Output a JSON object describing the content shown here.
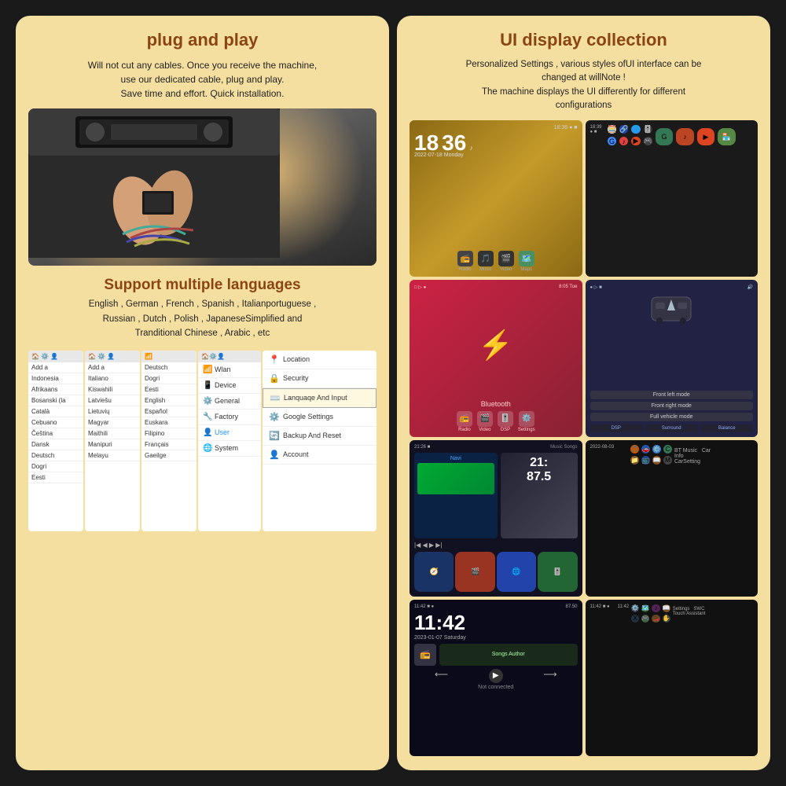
{
  "left": {
    "plug_title": "plug and play",
    "plug_body": "Will not cut any cables. Once you receive the machine,\nuse our dedicated cable, plug and play.\nSave time and effort. Quick installation.",
    "languages_title": "Support multiple languages",
    "languages_body": "English , German , French , Spanish , Italianportuguese ,\nRussian , Dutch , Polish , JapaneseSimplified and\nTranditional Chinese , Arabic , etc",
    "lang_list": [
      "Afrikaans",
      "Bosanski (la",
      "Català",
      "Cebuano",
      "Čeština",
      "Dansk",
      "Deutsch",
      "Dogri",
      "Eesti"
    ],
    "lang_list2": [
      "Indonesia",
      "Italiano",
      "Kiswahili",
      "Latviešu",
      "Lietuvių",
      "Magyar",
      "Maithili",
      "Manipuri",
      "Melayu"
    ],
    "lang_list3": [
      "Deutsch",
      "Dogri",
      "Eesti",
      "English",
      "Español",
      "Euskara",
      "Filipino",
      "Français",
      "Gaeilge"
    ],
    "menu_items": [
      "Wlan",
      "Device",
      "General",
      "Factory",
      "User",
      "System"
    ],
    "menu_icons": [
      "📶",
      "📱",
      "⚙️",
      "🔧",
      "👤",
      "🌐"
    ],
    "settings_items": [
      "Location",
      "Security",
      "Lanquaqe And Input",
      "Google Settings",
      "Backup And Reset",
      "Account"
    ],
    "settings_icons": [
      "📍",
      "🔒",
      "⌨️",
      "⚙️",
      "🔄",
      "👤"
    ]
  },
  "right": {
    "title": "UI display collection",
    "body": "Personalized Settings , various styles ofUI interface can be\nchanged at willNote !\nThe machine displays the UI differently for different\nconfigurations",
    "cells": [
      {
        "id": 1,
        "time": "18",
        "time2": "36",
        "label": "clock-home"
      },
      {
        "id": 2,
        "label": "app-grid"
      },
      {
        "id": 3,
        "label": "bluetooth"
      },
      {
        "id": 4,
        "label": "car-dsp"
      },
      {
        "id": 5,
        "label": "music"
      },
      {
        "id": 6,
        "label": "app-grid-2"
      },
      {
        "id": 7,
        "time": "11:42",
        "label": "clock-2"
      },
      {
        "id": 8,
        "label": "maps"
      }
    ],
    "dsp_modes": [
      "Front left mode",
      "Front right mode",
      "Full vehicle mode"
    ],
    "dsp_btns": [
      "DSP",
      "Surround",
      "Balance"
    ],
    "bottom_nav": [
      "Radio",
      "Video",
      "DSP",
      "Settings"
    ],
    "bottom_nav2": [
      "Navi",
      "Video Player",
      "Chrome",
      "DSP Equalizer"
    ],
    "clock2_time": "11:42",
    "clock2_date": "2023-01-07  Saturday",
    "apps_row1": [
      "📻",
      "🎵",
      "🎬",
      "🗺️",
      "📶",
      "🎵",
      "▶️",
      "🏪"
    ],
    "apps_row2": [
      "⚡",
      "🚗",
      "🛞",
      "🎵",
      "📁",
      "📺",
      "📖",
      "📋"
    ]
  }
}
